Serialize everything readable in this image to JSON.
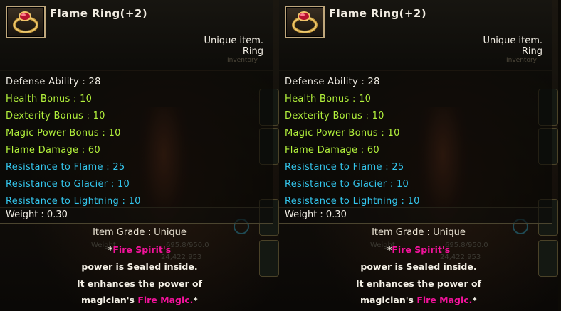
{
  "item": {
    "name": "Flame Ring(+2)",
    "rarity": "Unique item.",
    "type": "Ring",
    "inventory_label": "Inventory",
    "icon": "ring-icon"
  },
  "stats": [
    {
      "label": "Defense Ability : 28",
      "color": "white"
    },
    {
      "label": "Health Bonus : 10",
      "color": "green"
    },
    {
      "label": "Dexterity Bonus : 10",
      "color": "green"
    },
    {
      "label": "Magic Power Bonus : 10",
      "color": "green"
    },
    {
      "label": "Flame Damage : 60",
      "color": "green"
    },
    {
      "label": "Resistance to Flame : 25",
      "color": "cyan"
    },
    {
      "label": "Resistance to Glacier : 10",
      "color": "cyan"
    },
    {
      "label": "Resistance to Lightning : 10",
      "color": "cyan"
    }
  ],
  "weight": "Weight : 0.30",
  "grade": "Item Grade : Unique",
  "description": {
    "line1_prefix": "*",
    "line1_highlight": "Fire Spirit's",
    "line2": "power is Sealed inside.",
    "line3": "It enhances the power of",
    "line4_prefix": "magician's ",
    "line4_highlight": "Fire Magic.",
    "line4_suffix": "*"
  },
  "background": {
    "weight_label": "Weight",
    "weight_value": "695.8/950.0",
    "gold_value": "24,422,953"
  },
  "colors": {
    "white_text": "#f2efe6",
    "green_text": "#b3f23c",
    "cyan_text": "#34c7ee",
    "magenta_text": "#f2129b"
  }
}
